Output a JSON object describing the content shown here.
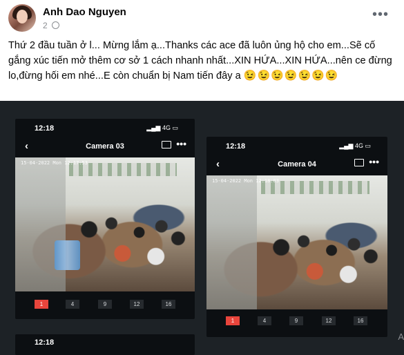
{
  "post": {
    "author": "Anh Dao Nguyen",
    "subline": "2",
    "text": "Thứ 2 đầu tuần ở l... Mừng lắm ạ...Thanks các ace đã luôn ủng hộ cho em...Sẽ cố gắng xúc tiến mở thêm cơ sở 1 cách nhanh nhất...XIN HỨA...XIN HỨA...nên ce đừng lo,đừng hối em nhé...E còn chuẩn bị Nam tiến đây a",
    "emojis": "😉😉😉😉😉😉😉"
  },
  "cameras": [
    {
      "time": "12:18",
      "signal": "4G",
      "title": "Camera 03",
      "overlay": "15-04-2022 Mon 12:17:53",
      "channels": [
        "1",
        "4",
        "9",
        "12",
        "16"
      ],
      "active_channel": "1"
    },
    {
      "time": "12:18",
      "signal": "4G",
      "title": "Camera 04",
      "overlay": "15-04-2022 Mon 12:18:03",
      "channels": [
        "1",
        "4",
        "9",
        "12",
        "16"
      ],
      "active_channel": "1"
    }
  ],
  "partial_phone": {
    "time": "12:18"
  },
  "edge_letter": "A",
  "icons": {
    "more": "more-horizontal-icon",
    "back": "chevron-left-icon",
    "screen": "screen-icon",
    "battery": "battery-icon"
  },
  "colors": {
    "media_bg": "#1d2226",
    "active_channel": "#e8453c",
    "text": "#050505",
    "muted": "#8a8d91"
  }
}
